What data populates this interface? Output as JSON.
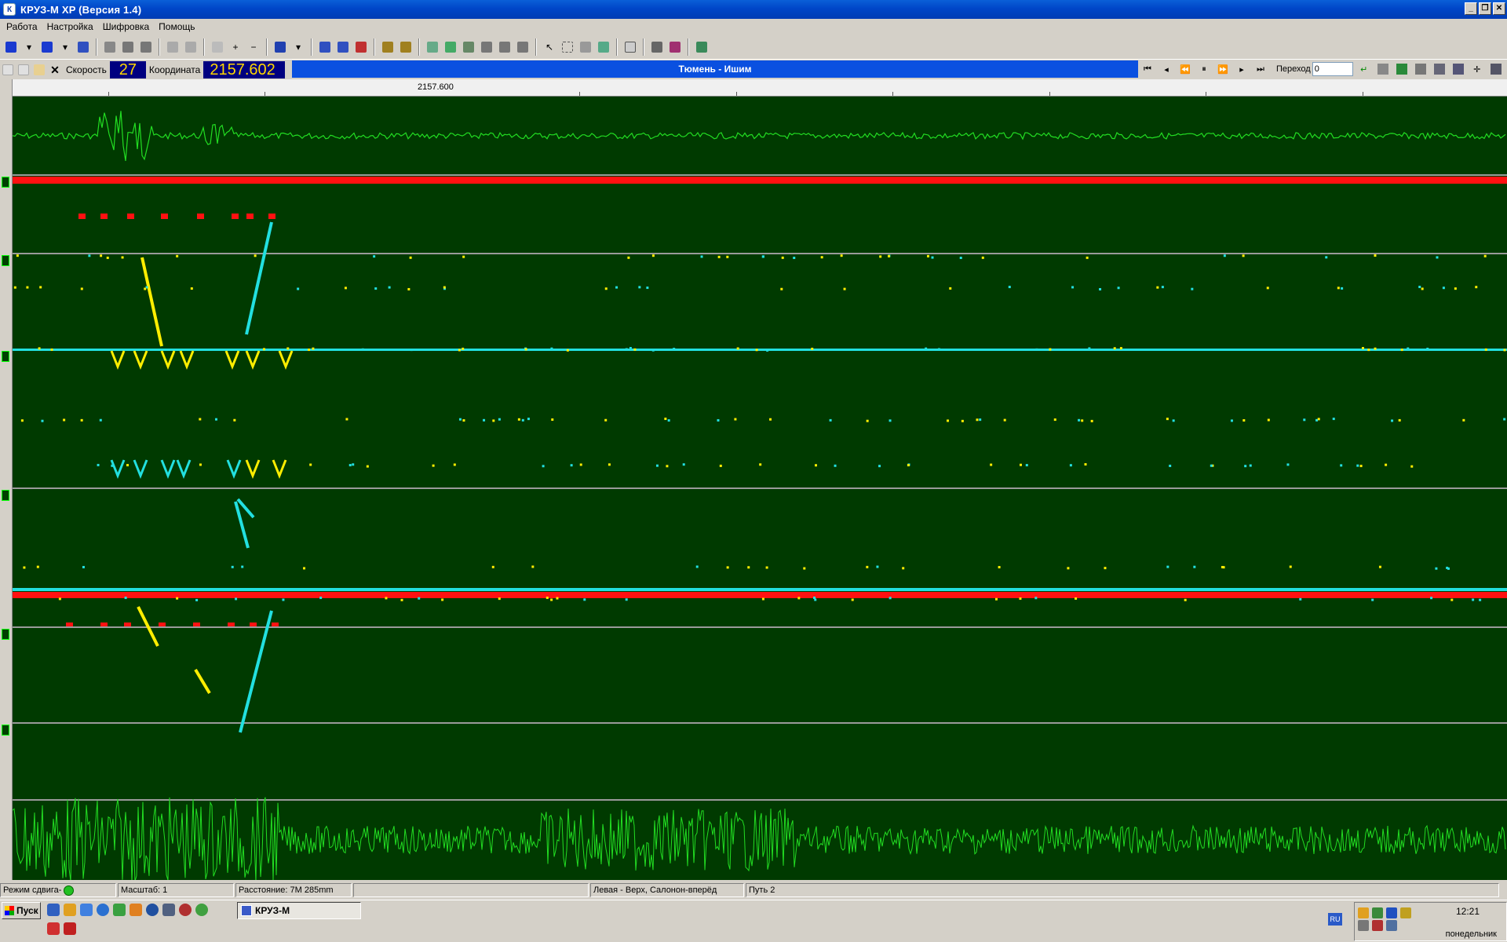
{
  "window": {
    "title": "КРУЗ-М XP (Версия 1.4)"
  },
  "menu": [
    "Работа",
    "Настройка",
    "Шифровка",
    "Помощь"
  ],
  "nav": {
    "speed_label": "Скорость",
    "speed_value": "27",
    "coord_label": "Координата",
    "coord_value": "2157.602",
    "route": "Тюмень - Ишим",
    "goto_label": "Переход",
    "goto_value": "0"
  },
  "ruler": {
    "label": "2157.600"
  },
  "status": {
    "mode": "Режим сдвига-",
    "scale": "Масштаб: 1",
    "distance": "Расстояние: 7М 285mm",
    "side": "Левая - Верх, Салонон-вперёд",
    "track": "Путь 2"
  },
  "taskbar": {
    "start": "Пуск",
    "task": "КРУЗ-М",
    "lang": "RU",
    "time": "12:21",
    "day": "понедельник"
  },
  "colors": {
    "plot_bg": "#003a00",
    "trace": "#22dd22",
    "yellow": "#ffee00",
    "cyan": "#22e0e0",
    "red": "#ff1111",
    "divider": "#9a9a9a"
  }
}
